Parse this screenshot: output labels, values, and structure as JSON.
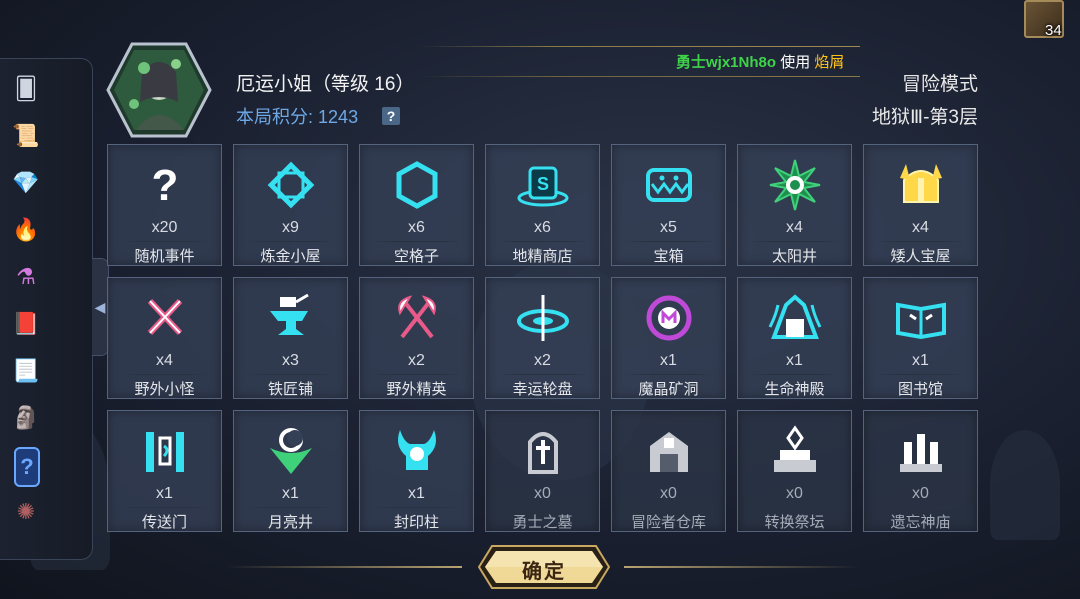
{
  "header": {
    "hero_name": "厄运小姐（等级 16）",
    "score_label": "本局积分:",
    "score_value": "1243",
    "help_glyph": "?",
    "mode": "冒险模式",
    "floor": "地狱Ⅲ-第3层"
  },
  "broadcast": {
    "player": "勇士wjx1Nh8o",
    "action": " 使用 ",
    "item": "焰屑"
  },
  "deck": {
    "count": "34"
  },
  "sidebar": {
    "items": [
      {
        "icon": "scroll-card-icon"
      },
      {
        "icon": "treasure-map-icon"
      },
      {
        "icon": "diamond-icon"
      },
      {
        "icon": "torch-icon"
      },
      {
        "icon": "potion-icon"
      },
      {
        "icon": "spellbook-icon"
      },
      {
        "icon": "parchment-icon"
      },
      {
        "icon": "moai-statue-icon"
      },
      {
        "icon": "mystery-card-icon"
      },
      {
        "icon": "spiked-ring-icon"
      }
    ],
    "collapse_glyph": "◀"
  },
  "tiles": [
    {
      "icon": "question-icon",
      "count": "x20",
      "label": "随机事件",
      "active": true
    },
    {
      "icon": "alchemy-frame-icon",
      "count": "x9",
      "label": "炼金小屋",
      "active": true
    },
    {
      "icon": "hexagon-icon",
      "count": "x6",
      "label": "空格子",
      "active": true
    },
    {
      "icon": "goblin-hat-icon",
      "count": "x6",
      "label": "地精商店",
      "active": true
    },
    {
      "icon": "chest-mimic-icon",
      "count": "x5",
      "label": "宝箱",
      "active": true
    },
    {
      "icon": "sun-icon",
      "count": "x4",
      "label": "太阳井",
      "active": true
    },
    {
      "icon": "dwarf-helmet-icon",
      "count": "x4",
      "label": "矮人宝屋",
      "active": true
    },
    {
      "icon": "crossed-swords-icon",
      "count": "x4",
      "label": "野外小怪",
      "active": true
    },
    {
      "icon": "anvil-icon",
      "count": "x3",
      "label": "铁匠铺",
      "active": true
    },
    {
      "icon": "crossed-axes-icon",
      "count": "x2",
      "label": "野外精英",
      "active": true
    },
    {
      "icon": "wheel-icon",
      "count": "x2",
      "label": "幸运轮盘",
      "active": true
    },
    {
      "icon": "crystal-mine-icon",
      "count": "x1",
      "label": "魔晶矿洞",
      "active": true
    },
    {
      "icon": "life-temple-icon",
      "count": "x1",
      "label": "生命神殿",
      "active": true
    },
    {
      "icon": "book-icon",
      "count": "x1",
      "label": "图书馆",
      "active": true
    },
    {
      "icon": "portal-icon",
      "count": "x1",
      "label": "传送门",
      "active": true
    },
    {
      "icon": "moon-well-icon",
      "count": "x1",
      "label": "月亮井",
      "active": true
    },
    {
      "icon": "seal-pillar-icon",
      "count": "x1",
      "label": "封印柱",
      "active": true
    },
    {
      "icon": "tombstone-icon",
      "count": "x0",
      "label": "勇士之墓",
      "active": false
    },
    {
      "icon": "warehouse-icon",
      "count": "x0",
      "label": "冒险者仓库",
      "active": false
    },
    {
      "icon": "altar-icon",
      "count": "x0",
      "label": "转换祭坛",
      "active": false
    },
    {
      "icon": "forgotten-temple-icon",
      "count": "x0",
      "label": "遗忘神庙",
      "active": false
    }
  ],
  "confirm_label": "确定",
  "colors": {
    "icon_cyan": "#35e0f0",
    "icon_gold": "#ffd84a",
    "icon_pink": "#e85a8a",
    "icon_purple": "#c04ad8",
    "icon_green": "#3ed17a",
    "icon_gray": "#c8ccd2",
    "score_blue": "#6ea8e6"
  }
}
